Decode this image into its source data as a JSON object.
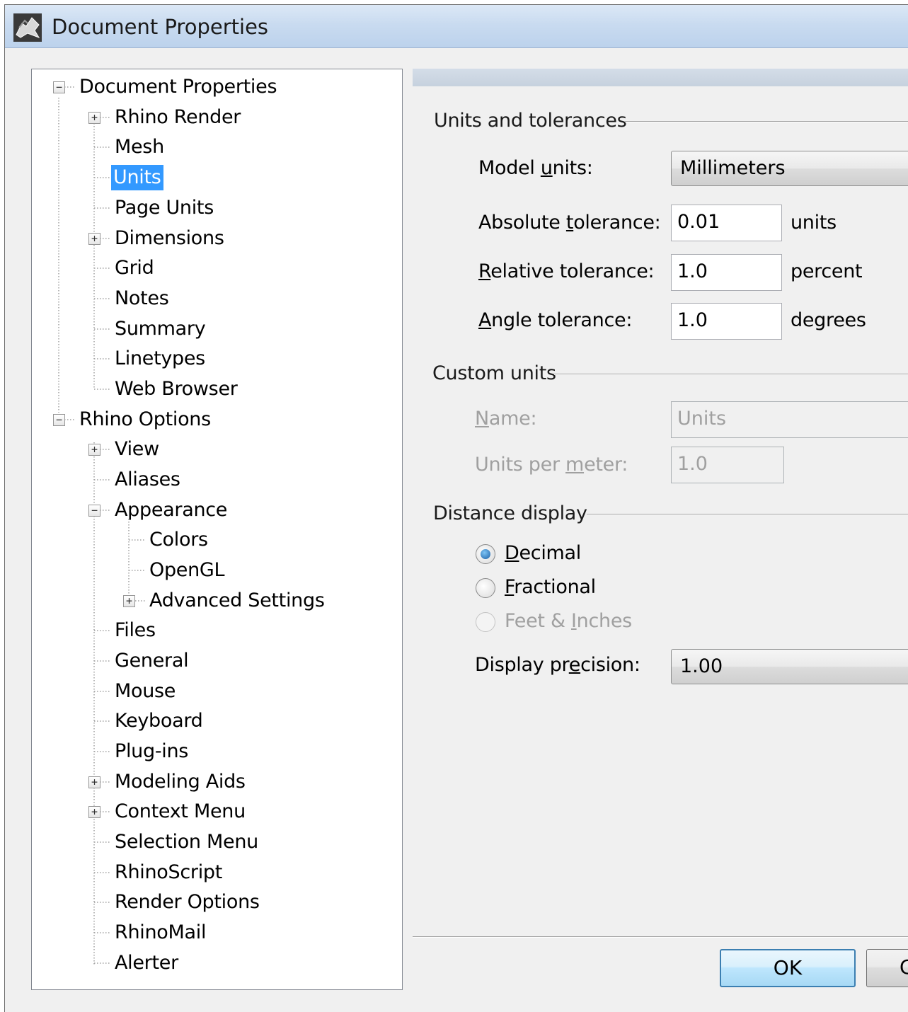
{
  "window": {
    "title": "Document Properties",
    "app_icon": "rhino-app-icon"
  },
  "tree": [
    {
      "label": "Document Properties",
      "expander": "−"
    },
    {
      "label": "Rhino Render",
      "expander": "+"
    },
    {
      "label": "Mesh"
    },
    {
      "label": "Units",
      "selected": true
    },
    {
      "label": "Page Units"
    },
    {
      "label": "Dimensions",
      "expander": "+"
    },
    {
      "label": "Grid"
    },
    {
      "label": "Notes"
    },
    {
      "label": "Summary"
    },
    {
      "label": "Linetypes"
    },
    {
      "label": "Web Browser"
    },
    {
      "label": "Rhino Options",
      "expander": "−"
    },
    {
      "label": "View",
      "expander": "+"
    },
    {
      "label": "Aliases"
    },
    {
      "label": "Appearance",
      "expander": "−"
    },
    {
      "label": "Colors"
    },
    {
      "label": "OpenGL"
    },
    {
      "label": "Advanced Settings",
      "expander": "+"
    },
    {
      "label": "Files"
    },
    {
      "label": "General"
    },
    {
      "label": "Mouse"
    },
    {
      "label": "Keyboard"
    },
    {
      "label": "Plug-ins"
    },
    {
      "label": "Modeling Aids",
      "expander": "+"
    },
    {
      "label": "Context Menu",
      "expander": "+"
    },
    {
      "label": "Selection Menu"
    },
    {
      "label": "RhinoScript"
    },
    {
      "label": "Render Options"
    },
    {
      "label": "RhinoMail"
    },
    {
      "label": "Alerter"
    }
  ],
  "units_tolerances": {
    "title": "Units and tolerances",
    "model_units_label": {
      "pre": "Model ",
      "ul": "u",
      "post": "nits:"
    },
    "model_units_value": "Millimeters",
    "absolute_label": {
      "pre": "Absolute ",
      "ul": "t",
      "post": "olerance:"
    },
    "absolute_value": "0.01",
    "absolute_unit": "units",
    "relative_label": {
      "pre": "",
      "ul": "R",
      "post": "elative tolerance:"
    },
    "relative_value": "1.0",
    "relative_unit": "percent",
    "angle_label": {
      "pre": "",
      "ul": "A",
      "post": "ngle tolerance:"
    },
    "angle_value": "1.0",
    "angle_unit": "degrees"
  },
  "custom_units": {
    "title": "Custom units",
    "name_label": {
      "pre": "",
      "ul": "N",
      "post": "ame:"
    },
    "name_value": "Units",
    "per_meter_label": {
      "pre": "Units per ",
      "ul": "m",
      "post": "eter:"
    },
    "per_meter_value": "1.0"
  },
  "distance_display": {
    "title": "Distance display",
    "decimal": {
      "pre": "",
      "ul": "D",
      "post": "ecimal"
    },
    "fractional": {
      "pre": "",
      "ul": "F",
      "post": "ractional"
    },
    "feet_inches": {
      "pre": "Feet & ",
      "ul": "I",
      "post": "nches"
    },
    "precision_label": {
      "pre": "Display pr",
      "ul": "e",
      "post": "cision:"
    },
    "precision_value": "1.00"
  },
  "buttons": {
    "ok": "OK",
    "cancel": "C"
  },
  "colors": {
    "selection": "#3399ff",
    "dialog_bg": "#f0f0f0",
    "ok_border": "#3c7fb1"
  }
}
